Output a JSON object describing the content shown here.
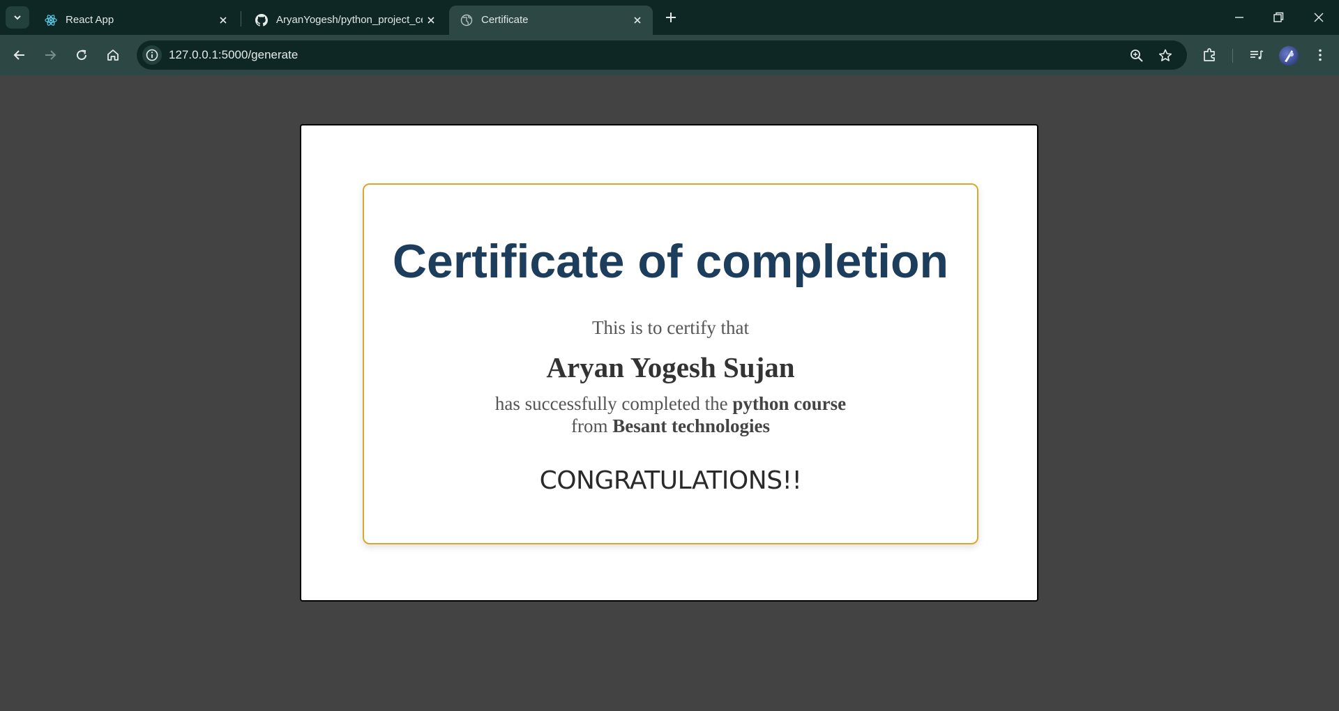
{
  "browser": {
    "tabs": [
      {
        "title": "React App",
        "icon": "react-icon",
        "active": false
      },
      {
        "title": "AryanYogesh/python_project_ce",
        "icon": "github-icon",
        "active": false
      },
      {
        "title": "Certificate",
        "icon": "globe-icon",
        "active": true
      }
    ],
    "address": {
      "url": "127.0.0.1:5000/generate"
    }
  },
  "certificate": {
    "title": "Certificate of completion",
    "certify_text": "This is to certify that",
    "recipient": "Aryan Yogesh Sujan",
    "completed_prefix": "has successfully completed the",
    "course": "python course",
    "from_prefix": "from",
    "institute": "Besant technologies",
    "congrats": "CONGRATULATIONS!!"
  },
  "colors": {
    "tabstrip": "#0f2724",
    "toolbar": "#2d4844",
    "page_background": "#434343",
    "title_color": "#1c3d5b",
    "border_accent": "#d9a62e"
  }
}
